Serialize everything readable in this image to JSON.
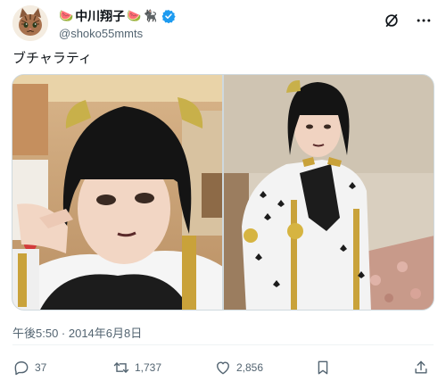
{
  "author": {
    "display_name": "中川翔子",
    "emoji_1": "🍉",
    "emoji_2": "🍉",
    "emoji_3": "🐈‍⬛",
    "handle": "@shoko55mmts",
    "verified_color": "#1d9bf0"
  },
  "tweet": {
    "text": "ブチャラティ",
    "timestamp": "午後5:50 · 2014年6月8日"
  },
  "icons": {
    "avatar": "cat-avatar-icon",
    "verified": "verified-badge-icon",
    "grok": "grok-icon",
    "more": "more-options-icon",
    "reply": "reply-icon",
    "retweet": "retweet-icon",
    "like": "like-icon",
    "bookmark": "bookmark-icon",
    "share": "share-icon"
  },
  "actions": {
    "reply_count": "37",
    "retweet_count": "1,737",
    "like_count": "2,856"
  },
  "colors": {
    "text_primary": "#0f1419",
    "text_secondary": "#536471",
    "accent": "#1d9bf0"
  }
}
